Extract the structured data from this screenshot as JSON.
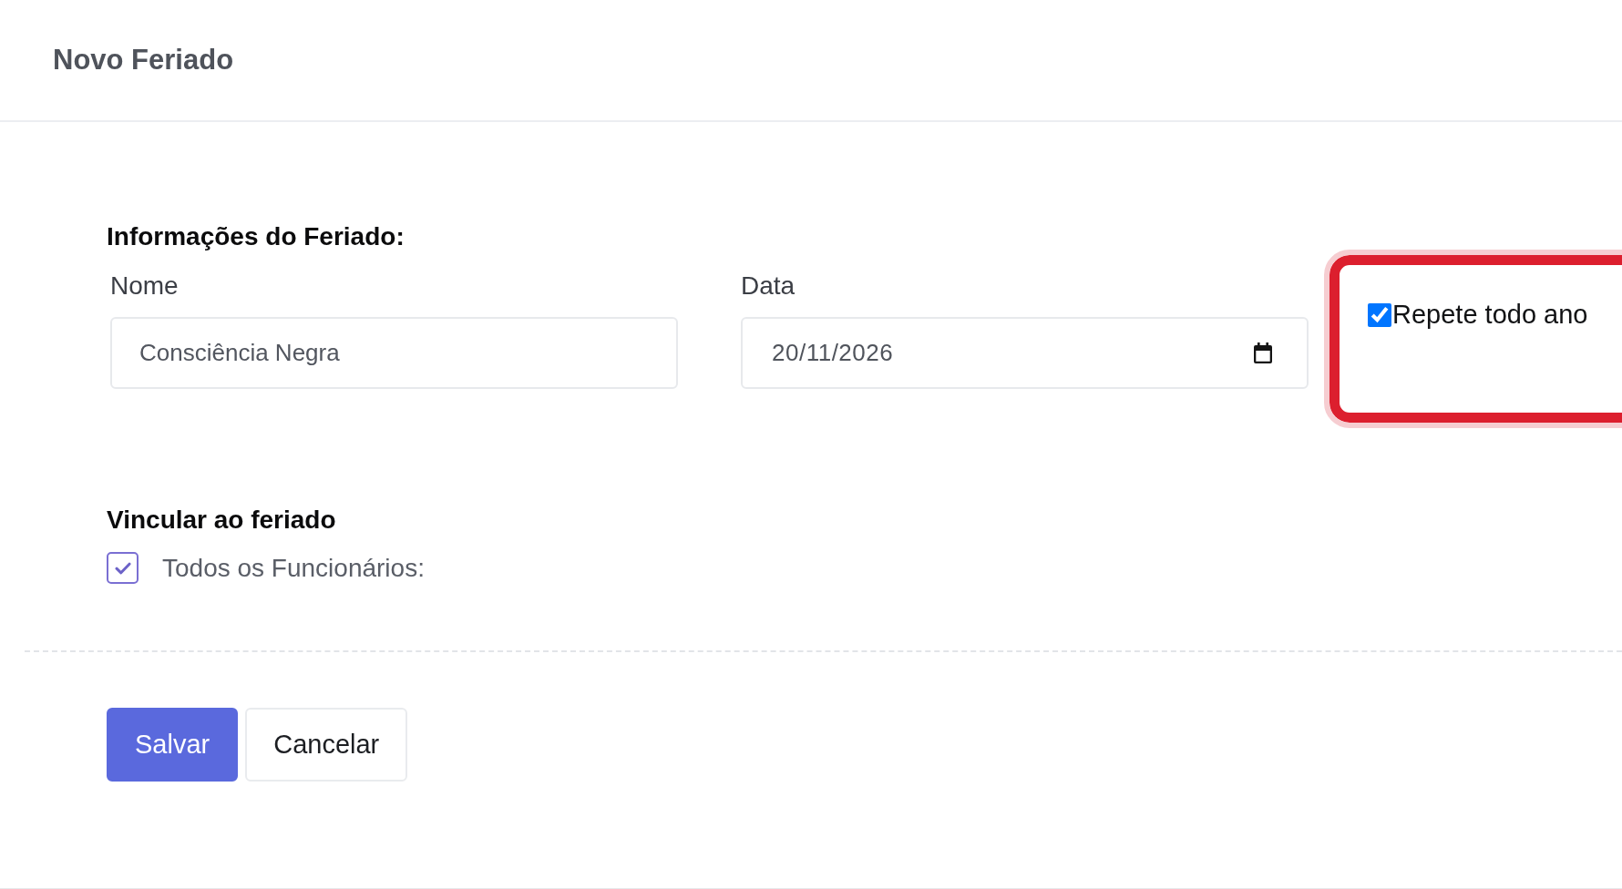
{
  "header": {
    "title": "Novo Feriado"
  },
  "holiday_info": {
    "heading": "Informações do Feriado:",
    "fields": [
      {
        "kind": "text",
        "label": "Nome",
        "value": "Consciência Negra"
      },
      {
        "kind": "date",
        "label": "Data",
        "value": "20/11/2026"
      }
    ],
    "repeat_yearly": {
      "label": "Repete todo ano",
      "checked": true,
      "highlighted": true
    }
  },
  "link": {
    "heading": "Vincular ao feriado",
    "options": [
      {
        "label": "Todos os Funcionários:",
        "checked": true
      }
    ]
  },
  "buttons": [
    {
      "kind": "save",
      "label": "Salvar"
    },
    {
      "kind": "cancel",
      "label": "Cancelar"
    }
  ]
}
